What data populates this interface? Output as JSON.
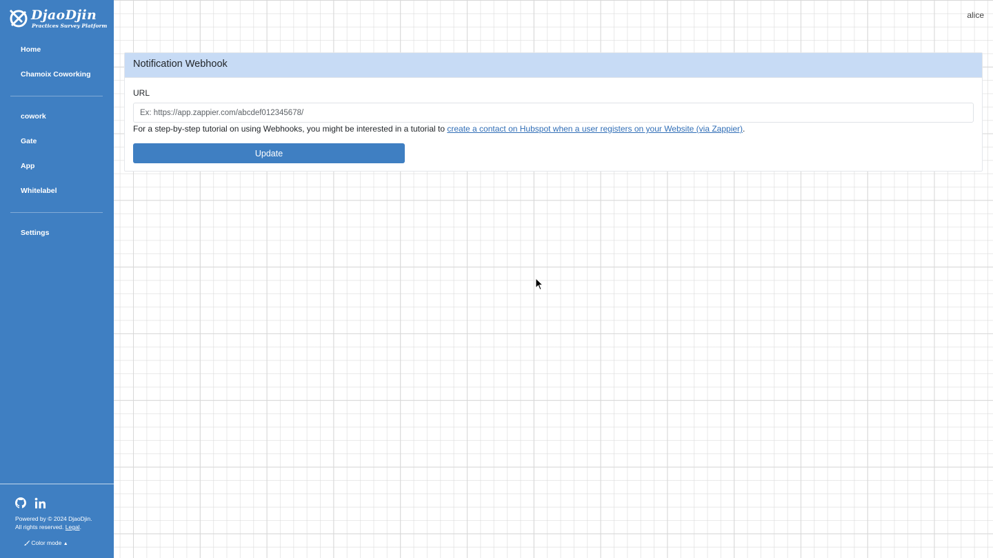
{
  "brand": {
    "name": "DjaoDjin",
    "tagline": "Practices Survey Platform"
  },
  "sidebar": {
    "items": [
      {
        "label": "Home"
      },
      {
        "label": "Chamoix Coworking"
      },
      {
        "label": "cowork"
      },
      {
        "label": "Gate"
      },
      {
        "label": "App"
      },
      {
        "label": "Whitelabel"
      },
      {
        "label": "Settings"
      }
    ],
    "footer": {
      "social": [
        "github-icon",
        "linkedin-icon"
      ],
      "powered_by": "Powered by © 2024 DjaoDjin.",
      "rights": "All rights reserved.",
      "legal_link": "Legal",
      "color_mode": "Color mode"
    }
  },
  "header": {
    "user": "alice"
  },
  "card": {
    "title": "Notification Webhook",
    "url_label": "URL",
    "url_value": "",
    "url_placeholder": "Ex: https://app.zappier.com/abcdef012345678/",
    "help_prefix": "For a step-by-step tutorial on using Webhooks, you might be interested in a tutorial to ",
    "help_link": "create a contact on Hubspot when a user registers on your Website (via Zappier)",
    "help_suffix": ".",
    "update_label": "Update"
  },
  "colors": {
    "sidebar_bg": "#3f7fc2",
    "card_header_bg": "#c7dbf5",
    "button_bg": "#3f7fc2",
    "link": "#2f6db6"
  }
}
